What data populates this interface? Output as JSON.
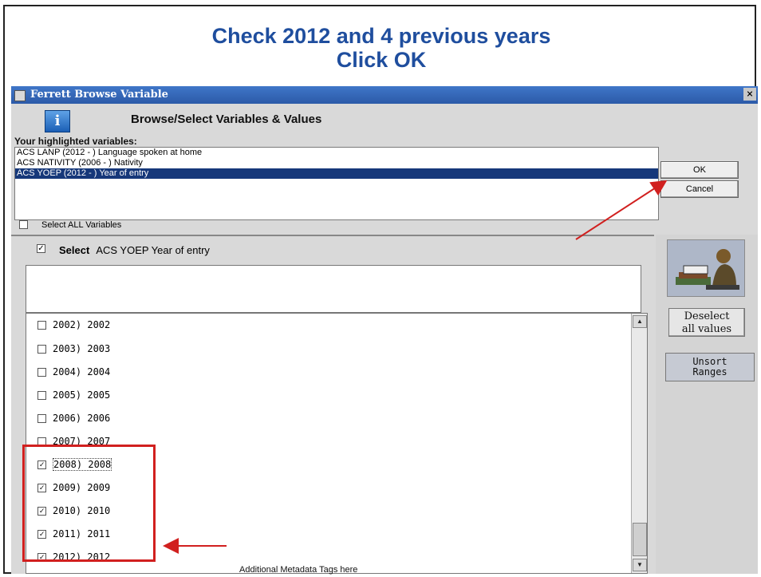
{
  "headline": {
    "line1": "Check 2012 and 4 previous years",
    "line2": "Click OK"
  },
  "window": {
    "title": "Ferrett Browse Variable",
    "close_label": "×"
  },
  "dialog": {
    "title": "Browse/Select Variables & Values",
    "highlighted_label": "Your highlighted variables:",
    "variables": [
      "ACS LANP (2012 - ) Language spoken at home",
      "ACS NATIVITY (2006 - ) Nativity",
      "ACS YOEP (2012 - ) Year of entry"
    ],
    "selected_variable_index": 2,
    "ok_label": "OK",
    "cancel_label": "Cancel",
    "select_all_label": "Select ALL Variables",
    "select_all_checked": false,
    "select_label": "Select",
    "select_variable": "ACS YOEP Year of entry",
    "select_checked": true
  },
  "values": [
    {
      "label": "2002) 2002",
      "checked": false
    },
    {
      "label": "2003) 2003",
      "checked": false
    },
    {
      "label": "2004) 2004",
      "checked": false
    },
    {
      "label": "2005) 2005",
      "checked": false
    },
    {
      "label": "2006) 2006",
      "checked": false
    },
    {
      "label": "2007) 2007",
      "checked": false
    },
    {
      "label": "2008) 2008",
      "checked": true
    },
    {
      "label": "2009) 2009",
      "checked": true
    },
    {
      "label": "2010) 2010",
      "checked": true
    },
    {
      "label": "2011) 2011",
      "checked": true
    },
    {
      "label": "2012) 2012",
      "checked": true
    }
  ],
  "side": {
    "deselect_line1": "Deselect",
    "deselect_line2": "all values",
    "unsort_line1": "Unsort",
    "unsort_line2": "Ranges"
  },
  "meta_label": "Additional Metadata Tags here",
  "colors": {
    "headline": "#1f4e9e",
    "annotation": "#d1201f",
    "titlebar": "#2c5aa8",
    "selection": "#16387a"
  }
}
